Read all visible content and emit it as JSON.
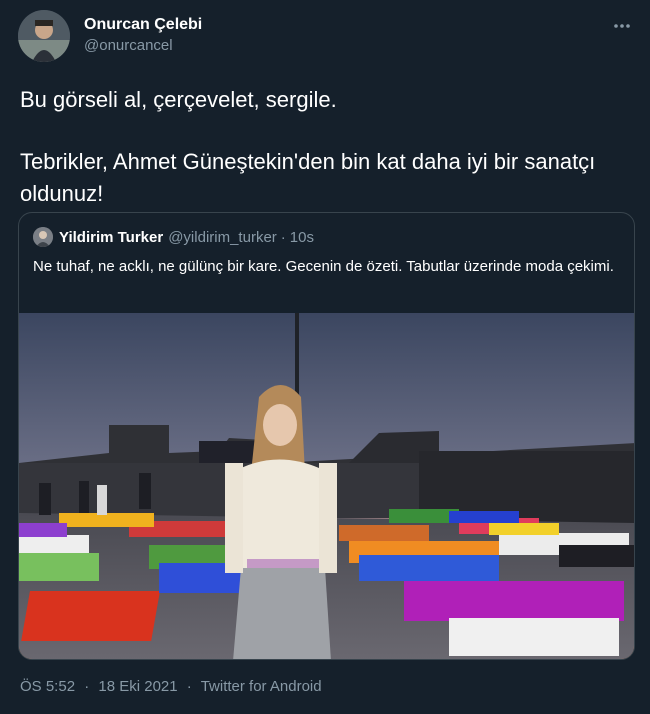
{
  "author": {
    "display_name": "Onurcan Çelebi",
    "handle": "@onurcancel"
  },
  "tweet": {
    "line1": "Bu görseli al, çerçevelet, sergile.",
    "line2": "Tebrikler, Ahmet Güneştekin'den bin kat daha iyi bir sanatçı oldunuz!"
  },
  "quoted": {
    "display_name": "Yildirim Turker",
    "handle": "@yildirim_turker",
    "separator": "·",
    "time": "10s",
    "text": "Ne tuhaf, ne acklı, ne gülünç bir kare. Gecenin de özeti. Tabutlar üzerinde moda çekimi."
  },
  "footer": {
    "time": "ÖS 5:52",
    "separator1": "·",
    "date": "18 Eki 2021",
    "separator2": "·",
    "source": "Twitter for Android"
  },
  "icons": {
    "more": "more-horizontal-icon"
  },
  "colors": {
    "background": "#15202b",
    "secondary_text": "#8899a6",
    "border": "#38444d"
  }
}
